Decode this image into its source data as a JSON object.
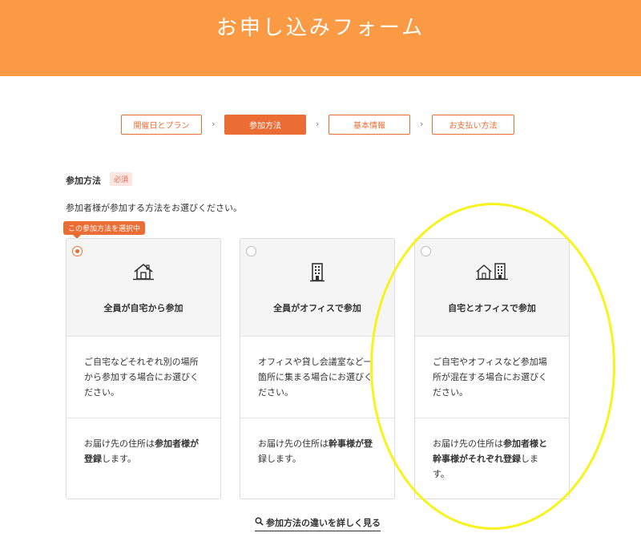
{
  "header": {
    "title": "お申し込みフォーム"
  },
  "steps": [
    {
      "label": "開催日とプラン",
      "active": false
    },
    {
      "label": "参加方法",
      "active": true
    },
    {
      "label": "基本情報",
      "active": false
    },
    {
      "label": "お支払い方法",
      "active": false
    }
  ],
  "step_separator": "›",
  "section": {
    "label": "参加方法",
    "required": "必須",
    "description": "参加者様が参加する方法をお選びください。",
    "selected_badge": "この参加方法を選択中"
  },
  "cards": [
    {
      "icon": "house-icon",
      "title": "全員が自宅から参加",
      "description": "ご自宅などそれぞれ別の場所から参加する場合にお選びください。",
      "note_prefix": "お届け先の住所は",
      "note_bold": "参加者様が登録",
      "note_suffix": "します。",
      "selected": true
    },
    {
      "icon": "office-building-icon",
      "title": "全員がオフィスで参加",
      "description": "オフィスや貸し会議室など一箇所に集まる場合にお選びください。",
      "note_prefix": "お届け先の住所は",
      "note_bold": "幹事様が登",
      "note_suffix": "録します。",
      "selected": false
    },
    {
      "icon": "house-and-building-icon",
      "title": "自宅とオフィスで参加",
      "description": "ご自宅やオフィスなど参加場所が混在する場合にお選びください。",
      "note_prefix": "お届け先の住所は",
      "note_bold": "参加者様と幹事様がそれぞれ登録",
      "note_suffix": "します。",
      "selected": false
    }
  ],
  "details_link": "参加方法の違いを詳しく見る",
  "colors": {
    "header": "#fb9a44",
    "accent": "#ec6d33",
    "annotation": "#f7f31c"
  }
}
